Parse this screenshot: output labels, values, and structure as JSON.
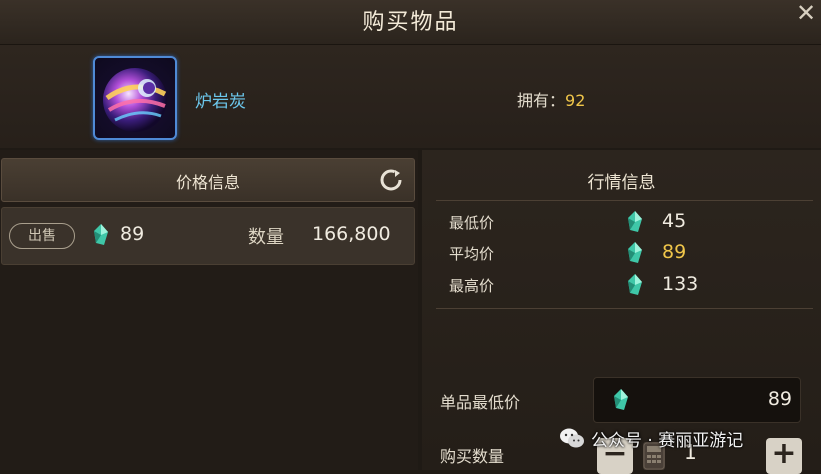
{
  "dialog": {
    "title": "购买物品"
  },
  "item": {
    "name": "炉岩炭",
    "owned_label": "拥有：",
    "owned_count": "92"
  },
  "price_info": {
    "header": "价格信息",
    "listing": {
      "badge": "出售",
      "price": "89",
      "quantity_label": "数量",
      "quantity": "166,800"
    }
  },
  "market_info": {
    "header": "行情信息",
    "stats": [
      {
        "label": "最低价",
        "value": "45"
      },
      {
        "label": "平均价",
        "value": "89"
      },
      {
        "label": "最高价",
        "value": "133"
      }
    ],
    "unit_lowest_label": "单品最低价",
    "unit_lowest_value": "89",
    "buy_quantity_label": "购买数量",
    "buy_quantity_value": "1"
  },
  "watermark": {
    "text": "公众号 · 赛丽亚游记"
  },
  "colors": {
    "item_name": "#6cc7ec",
    "highlight": "#f0c64a",
    "panel_dark": "#221c17",
    "icon_border": "#4f8ad6"
  },
  "icons": {
    "close": "close-icon",
    "refresh": "refresh-icon",
    "currency": "gem-icon",
    "calculator": "calculator-icon",
    "wechat": "wechat-icon"
  }
}
